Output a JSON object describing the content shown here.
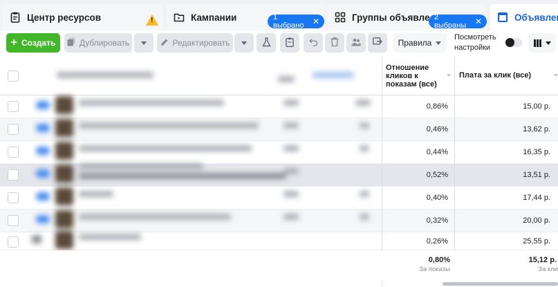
{
  "tabs": {
    "resources": {
      "label": "Центр ресурсов",
      "warning_icon": "warning-icon"
    },
    "campaigns": {
      "label": "Кампании",
      "chip": "1 выбрано"
    },
    "adsets": {
      "label": "Группы объявле...",
      "chip": "2 выбраны"
    },
    "ads": {
      "label": "Объявлени"
    }
  },
  "toolbar": {
    "create": "Создать",
    "duplicate": "Дублировать",
    "edit": "Редактировать",
    "rules": "Правила",
    "view_settings": "Посмотреть настройки"
  },
  "table": {
    "columns": [
      {
        "label": "Отношение кликов к показам (все)"
      },
      {
        "label": "Плата за клик (все)"
      }
    ],
    "rows": [
      {
        "ctr": "0,86%",
        "cpc": "15,00 р."
      },
      {
        "ctr": "0,46%",
        "cpc": "13,62 р."
      },
      {
        "ctr": "0,44%",
        "cpc": "16,35 р."
      },
      {
        "ctr": "0,52%",
        "cpc": "13,51 р."
      },
      {
        "ctr": "0,40%",
        "cpc": "17,44 р."
      },
      {
        "ctr": "0,32%",
        "cpc": "20,00 р."
      },
      {
        "ctr": "0,26%",
        "cpc": "25,55 р."
      }
    ],
    "totals": {
      "ctr": "0,80%",
      "ctr_sub": "За показы",
      "cpc": "15,12 р.",
      "cpc_sub": "За кли"
    }
  },
  "colors": {
    "accent": "#1877f2",
    "create_green": "#42b72a",
    "warning": "#f7b928"
  }
}
